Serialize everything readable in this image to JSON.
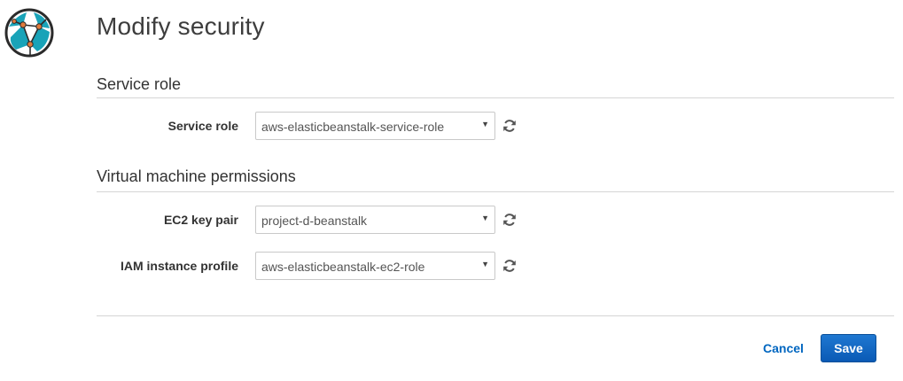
{
  "page": {
    "title": "Modify security"
  },
  "sections": {
    "service_role": {
      "header": "Service role",
      "field_label": "Service role",
      "value": "aws-elasticbeanstalk-service-role"
    },
    "vm_permissions": {
      "header": "Virtual machine permissions",
      "ec2_key_pair": {
        "label": "EC2 key pair",
        "value": "project-d-beanstalk"
      },
      "iam_instance_profile": {
        "label": "IAM instance profile",
        "value": "aws-elasticbeanstalk-ec2-role"
      }
    }
  },
  "footer": {
    "cancel_label": "Cancel",
    "save_label": "Save"
  },
  "icons": {
    "logo": "globe-network-logo-icon",
    "refresh": "refresh-icon",
    "select_caret": "caret-down-icon"
  },
  "colors": {
    "link": "#0066c0",
    "primary_button": "#0a5ab5",
    "logo_teal": "#19a3b8",
    "logo_orange": "#e07a3c"
  }
}
